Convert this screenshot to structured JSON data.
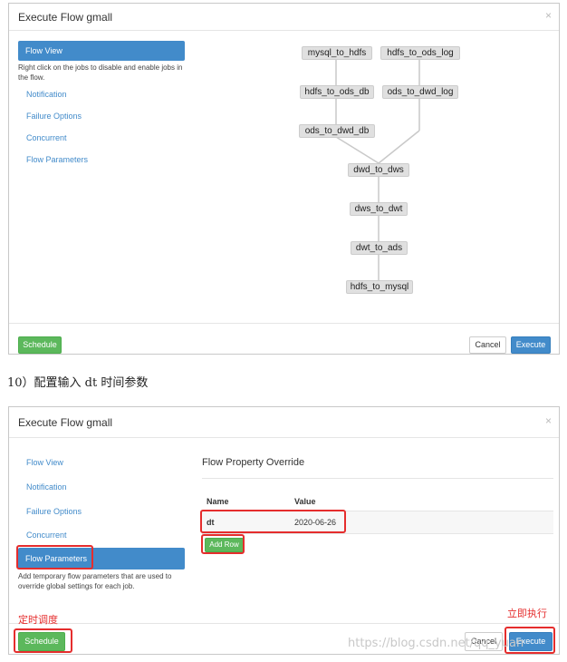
{
  "top_modal": {
    "title": "Execute Flow gmall",
    "close": "×",
    "nav_active": "Flow View",
    "nav_active_help": "Right click on the jobs to disable and enable jobs in the flow.",
    "nav_items": [
      "Notification",
      "Failure Options",
      "Concurrent",
      "Flow Parameters"
    ],
    "nodes": [
      "mysql_to_hdfs",
      "hdfs_to_ods_log",
      "hdfs_to_ods_db",
      "ods_to_dwd_log",
      "ods_to_dwd_db",
      "dwd_to_dws",
      "dws_to_dwt",
      "dwt_to_ads",
      "hdfs_to_mysql"
    ],
    "schedule_label": "Schedule",
    "cancel_label": "Cancel",
    "execute_label": "Execute"
  },
  "caption": "10）配置输入 dt 时间参数",
  "bottom_modal": {
    "title": "Execute Flow gmall",
    "close": "×",
    "nav_items": [
      "Flow View",
      "Notification",
      "Failure Options",
      "Concurrent"
    ],
    "nav_active": "Flow Parameters",
    "nav_active_help": "Add temporary flow parameters that are used to override global settings for each job.",
    "section_title": "Flow Property Override",
    "table": {
      "headers": [
        "Name",
        "Value"
      ],
      "rows": [
        [
          "dt",
          "2020-06-26"
        ]
      ]
    },
    "add_row_label": "Add Row",
    "schedule_label": "Schedule",
    "cancel_label": "Cancel",
    "execute_label": "Execute"
  },
  "annotations": {
    "schedule_note": "定时调度",
    "execute_note": "立即执行"
  },
  "watermark": "https://blog.csdn.net/qq_yuan",
  "colors": {
    "primary": "#428bca",
    "success": "#5cb85c",
    "highlight": "#e52d2d"
  }
}
